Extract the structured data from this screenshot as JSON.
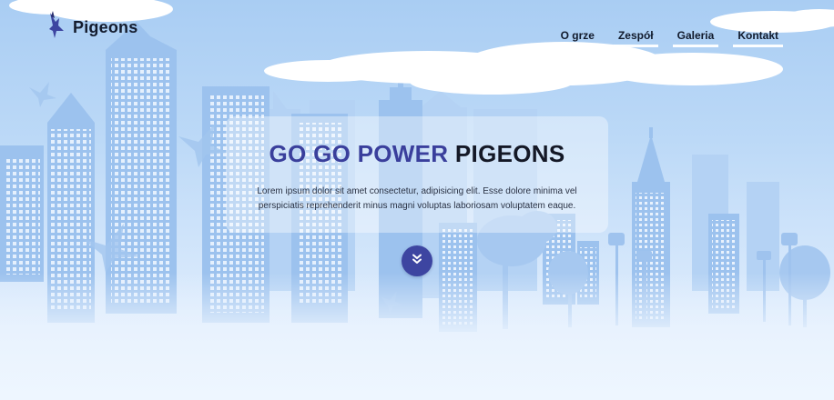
{
  "brand": {
    "name": "Pigeons",
    "logo_icon": "pigeon-icon"
  },
  "nav": {
    "items": [
      "O grze",
      "Zespół",
      "Galeria",
      "Kontakt"
    ]
  },
  "hero": {
    "title_accent": "GO GO POWER",
    "title_main": "PIGEONS",
    "description": "Lorem ipsum dolor sit amet consectetur, adipisicing elit. Esse dolore minima vel perspiciatis reprehenderit minus magni voluptas laboriosam voluptatem eaque.",
    "scroll_icon": "double-chevron-down-icon"
  },
  "colors": {
    "accent": "#3a3f9c",
    "button": "#3d45a1",
    "sky": "#a9cdf3"
  }
}
